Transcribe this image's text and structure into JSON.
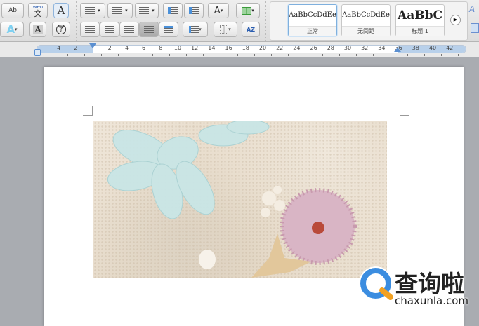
{
  "toolbar": {
    "row1": [
      "phonetic-guide",
      "wen-chinese-layout",
      "character-border",
      "bullets",
      "numbering",
      "multilevel-list",
      "decrease-indent",
      "increase-indent",
      "text-direction",
      "columns"
    ],
    "wen_label": "wen",
    "wen_char": "文",
    "char_border_label": "A",
    "enclose_char": "字",
    "text_effect_label": "A",
    "shade_label": "A",
    "sort_label": "AZ",
    "styles": [
      {
        "preview": "AaBbCcDdEe",
        "label": "正常",
        "selected": true
      },
      {
        "preview": "AaBbCcDdEe",
        "label": "无间距",
        "selected": false
      },
      {
        "preview": "AaBbC",
        "label": "标题 1",
        "selected": false
      }
    ]
  },
  "ruler": {
    "left_labels": [
      "4",
      "2"
    ],
    "labels": [
      "2",
      "4",
      "6",
      "8",
      "10",
      "12",
      "14",
      "16",
      "18",
      "20",
      "22",
      "24",
      "26",
      "28",
      "30",
      "32",
      "34",
      "36",
      "38",
      "40",
      "42"
    ]
  },
  "watermark": {
    "brand": "查询啦",
    "url": "chaxunla.com"
  }
}
